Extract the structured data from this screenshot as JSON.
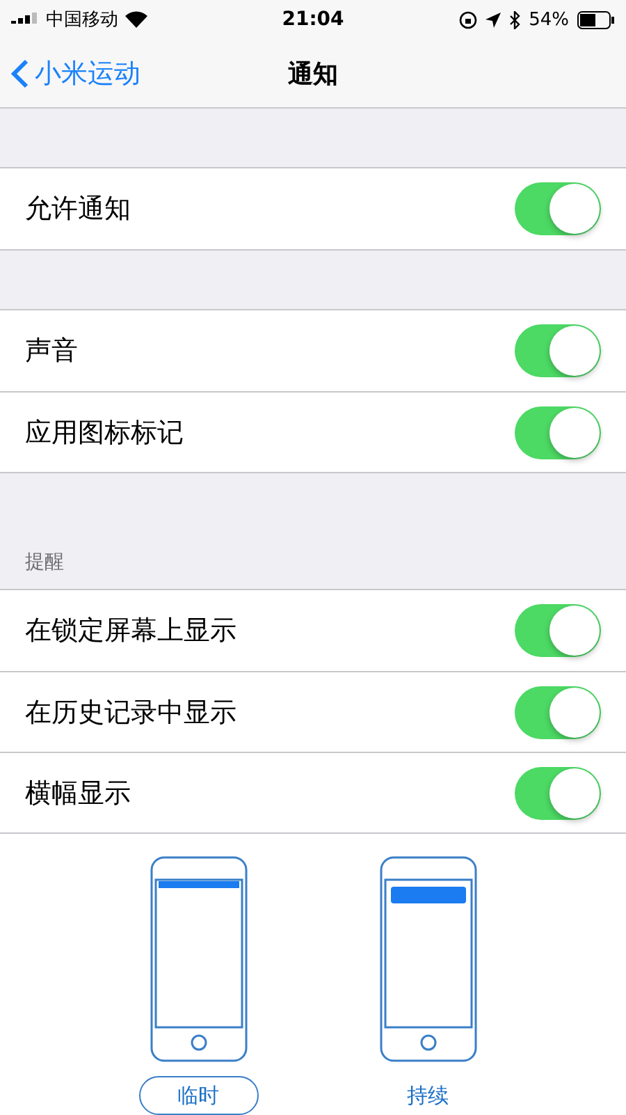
{
  "status_bar": {
    "carrier": "中国移动",
    "time": "21:04",
    "battery": "54%"
  },
  "nav": {
    "back": "小米运动",
    "title": "通知"
  },
  "groups": [
    {
      "rows": [
        {
          "label": "允许通知",
          "on": true
        }
      ]
    },
    {
      "rows": [
        {
          "label": "声音",
          "on": true
        },
        {
          "label": "应用图标标记",
          "on": true
        }
      ]
    },
    {
      "header": "提醒",
      "rows": [
        {
          "label": "在锁定屏幕上显示",
          "on": true
        },
        {
          "label": "在历史记录中显示",
          "on": true
        },
        {
          "label": "横幅显示",
          "on": true
        }
      ]
    }
  ],
  "banner_styles": [
    {
      "kind": "temporary",
      "label": "临时",
      "selected": true
    },
    {
      "kind": "persistent",
      "label": "持续",
      "selected": false
    }
  ]
}
